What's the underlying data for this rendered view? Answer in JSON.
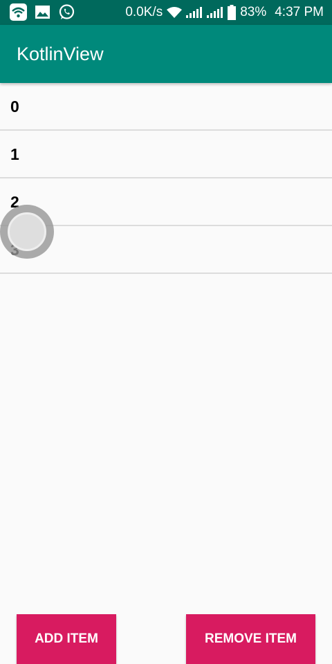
{
  "status_bar": {
    "network_speed": "0.0K/s",
    "battery_percent": "83%",
    "time": "4:37 PM",
    "icons": [
      "wifi-app-icon",
      "gallery-icon",
      "whatsapp-icon",
      "wifi-signal-icon",
      "cell-signal-icon",
      "cell-signal-icon",
      "battery-icon"
    ]
  },
  "app_bar": {
    "title": "KotlinView",
    "color": "#00897b"
  },
  "list": {
    "items": [
      {
        "label": "0"
      },
      {
        "label": "1"
      },
      {
        "label": "2"
      },
      {
        "label": "3"
      }
    ]
  },
  "buttons": {
    "add_label": "ADD ITEM",
    "remove_label": "REMOVE ITEM",
    "color": "#d81b60"
  }
}
